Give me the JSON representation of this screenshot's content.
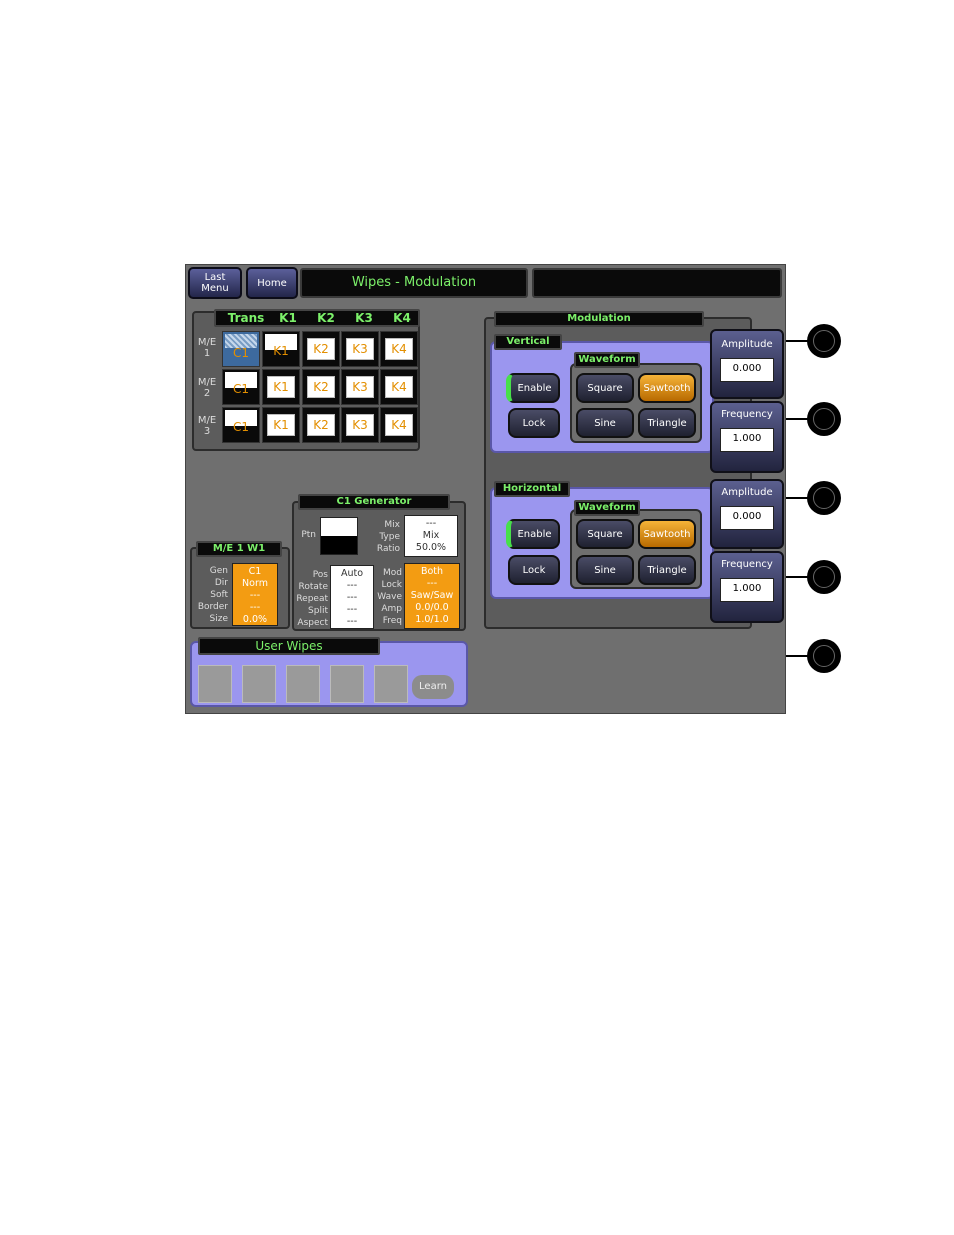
{
  "header": {
    "last_menu": "Last\nMenu",
    "home": "Home",
    "title": "Wipes - Modulation",
    "title2": ""
  },
  "trans_grid": {
    "headers": [
      "Trans",
      "K1",
      "K2",
      "K3",
      "K4"
    ],
    "rows": [
      {
        "label": "M/E\n1",
        "cells": [
          "C1",
          "K1",
          "K2",
          "K3",
          "K4"
        ]
      },
      {
        "label": "M/E\n2",
        "cells": [
          "C1",
          "K1",
          "K2",
          "K3",
          "K4"
        ]
      },
      {
        "label": "M/E\n3",
        "cells": [
          "C1",
          "K1",
          "K2",
          "K3",
          "K4"
        ]
      }
    ]
  },
  "me_w1": {
    "title": "M/E 1 W1",
    "labels": [
      "Gen",
      "Dir",
      "Soft",
      "Border",
      "Size"
    ],
    "values": [
      "C1",
      "Norm",
      "---",
      "---",
      "0.0%"
    ]
  },
  "c1_generator": {
    "title": "C1 Generator",
    "ptn_label": "Ptn",
    "mix_labels": [
      "Mix",
      "Type",
      "Ratio"
    ],
    "mix_values": [
      "---",
      "Mix",
      "50.0%"
    ],
    "pos_labels": [
      "Pos",
      "Rotate",
      "Repeat",
      "Split",
      "Aspect"
    ],
    "pos_values": [
      "Auto",
      "---",
      "---",
      "---",
      "---"
    ],
    "mod_labels": [
      "Mod",
      "Lock",
      "Wave",
      "Amp",
      "Freq"
    ],
    "mod_values": [
      "Both",
      "---",
      "Saw/Saw",
      "0.0/0.0",
      "1.0/1.0"
    ]
  },
  "user_wipes": {
    "title": "User Wipes",
    "learn": "Learn"
  },
  "modulation": {
    "title": "Modulation",
    "vertical": {
      "title": "Vertical",
      "enable": "Enable",
      "lock": "Lock",
      "waveform_title": "Waveform",
      "square": "Square",
      "sawtooth": "Sawtooth",
      "sine": "Sine",
      "triangle": "Triangle"
    },
    "horizontal": {
      "title": "Horizontal",
      "enable": "Enable",
      "lock": "Lock",
      "waveform_title": "Waveform",
      "square": "Square",
      "sawtooth": "Sawtooth",
      "sine": "Sine",
      "triangle": "Triangle"
    }
  },
  "side": {
    "v_amp_label": "Amplitude",
    "v_amp_value": "0.000",
    "v_freq_label": "Frequency",
    "v_freq_value": "1.000",
    "h_amp_label": "Amplitude",
    "h_amp_value": "0.000",
    "h_freq_label": "Frequency",
    "h_freq_value": "1.000"
  },
  "colors": {
    "accent_green": "#7cf06a",
    "selected_orange": "#f39c12",
    "panel_violet": "#9b96ef",
    "background_gray": "#6f6f6f"
  }
}
